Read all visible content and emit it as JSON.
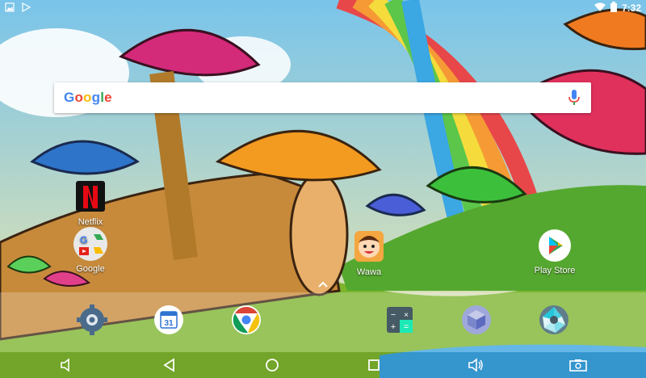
{
  "status_bar": {
    "time": "7:32",
    "left_icons": [
      "image-icon",
      "play-store-notification-icon"
    ],
    "right_icons": [
      "wifi-icon",
      "battery-icon"
    ]
  },
  "search": {
    "logo": "Google",
    "mic_icon": "mic-icon"
  },
  "desktop_apps": [
    {
      "label": "Netflix",
      "icon": "netflix-icon"
    },
    {
      "label": "Google",
      "icon": "google-folder-icon"
    },
    {
      "label": "Wawa",
      "icon": "wawa-icon"
    },
    {
      "label": "Play Store",
      "icon": "play-store-icon"
    }
  ],
  "dock": [
    {
      "icon": "settings-icon"
    },
    {
      "icon": "calendar-icon",
      "calendar_day": "31"
    },
    {
      "icon": "chrome-icon"
    },
    {
      "icon": "calculator-icon"
    },
    {
      "icon": "cube-app-icon"
    },
    {
      "icon": "camera-aperture-icon"
    }
  ],
  "navigation": [
    "volume-down-icon",
    "back-icon",
    "home-icon",
    "recents-icon",
    "volume-up-icon",
    "screenshot-icon"
  ],
  "colors": {
    "google_blue": "#4285F4",
    "google_red": "#EA4335",
    "google_yellow": "#FBBC05",
    "google_green": "#34A853"
  }
}
